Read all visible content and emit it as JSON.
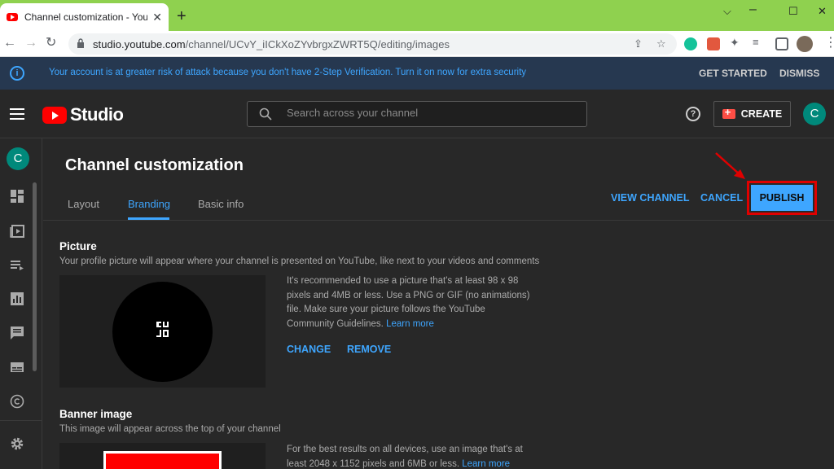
{
  "browser": {
    "tab_title": "Channel customization - YouTube",
    "tab_close": "✕",
    "new_tab": "+",
    "url_host": "studio.youtube.com",
    "url_path": "/channel/UCvY_iICkXoZYvbrgxZWRT5Q/editing/images"
  },
  "banner": {
    "message": "Your account is at greater risk of attack because you don't have 2-Step Verification. Turn it on now for extra security",
    "get_started": "GET STARTED",
    "dismiss": "DISMISS"
  },
  "header": {
    "logo_text": "Studio",
    "search_placeholder": "Search across your channel",
    "create_label": "CREATE",
    "avatar_letter": "C"
  },
  "sidebar": {
    "avatar_letter": "C",
    "items": [
      "dashboard-icon",
      "content-icon",
      "playlists-icon",
      "analytics-icon",
      "comments-icon",
      "subtitles-icon",
      "copyright-icon",
      "settings-icon"
    ]
  },
  "main": {
    "title": "Channel customization",
    "tabs": [
      "Layout",
      "Branding",
      "Basic info"
    ],
    "active_tab": "Branding",
    "view_channel": "VIEW CHANNEL",
    "cancel": "CANCEL",
    "publish": "PUBLISH",
    "picture": {
      "title": "Picture",
      "description": "Your profile picture will appear where your channel is presented on YouTube, like next to your videos and comments",
      "help_text": "It's recommended to use a picture that's at least 98 x 98 pixels and 4MB or less. Use a PNG or GIF (no animations) file. Make sure your picture follows the YouTube Community Guidelines.",
      "learn_more": "Learn more",
      "change": "CHANGE",
      "remove": "REMOVE"
    },
    "banner_image": {
      "title": "Banner image",
      "description": "This image will appear across the top of your channel",
      "help_text": "For the best results on all devices, use an image that's at least 2048 x 1152 pixels and 6MB or less.",
      "learn_more": "Learn more"
    }
  },
  "colors": {
    "accent": "#3ea6ff",
    "highlight": "#e00000",
    "brand": "#ff0000"
  }
}
